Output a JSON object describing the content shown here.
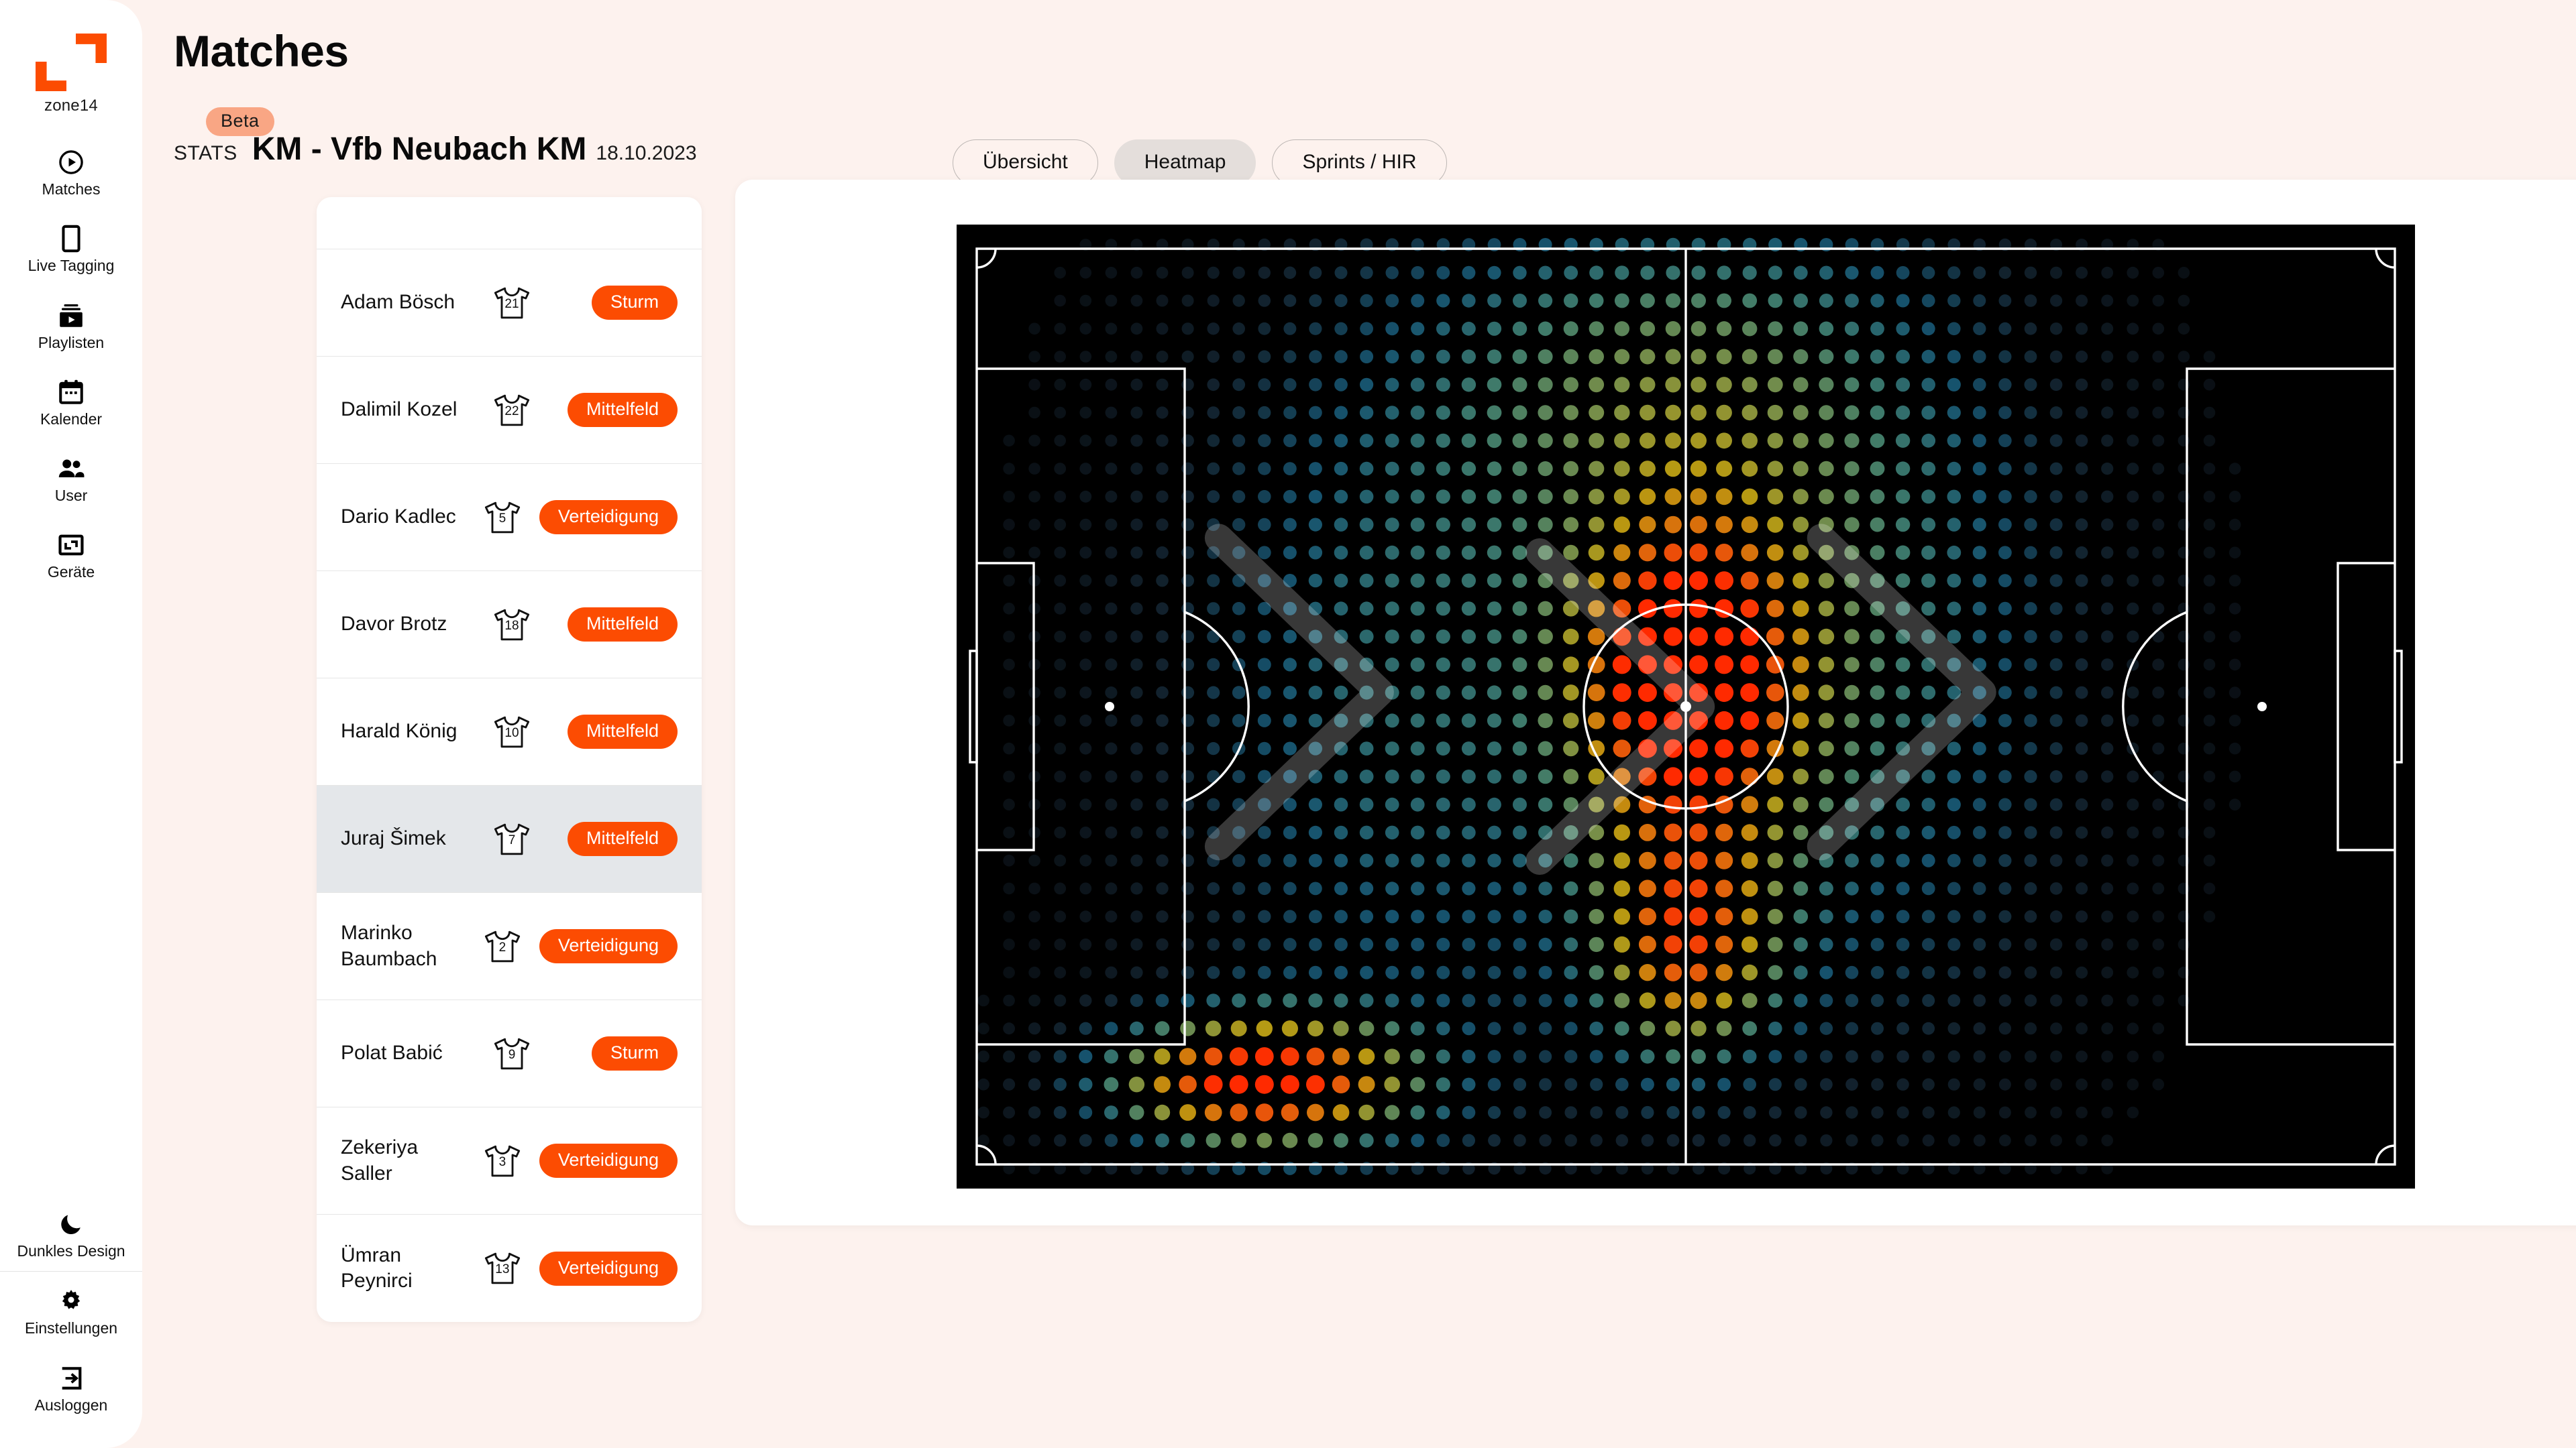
{
  "brand": {
    "name": "zone14",
    "logo_icon": "zone14-logo",
    "accent": "#FC4C02"
  },
  "sidebar": {
    "items": [
      {
        "label": "Matches",
        "icon": "play-circle-icon",
        "active": true
      },
      {
        "label": "Live Tagging",
        "icon": "mobile-icon",
        "active": false
      },
      {
        "label": "Playlisten",
        "icon": "playlist-icon",
        "active": false
      },
      {
        "label": "Kalender",
        "icon": "calendar-icon",
        "active": false
      },
      {
        "label": "User",
        "icon": "users-icon",
        "active": false
      },
      {
        "label": "Geräte",
        "icon": "devices-icon",
        "active": false
      }
    ],
    "bottom_items": [
      {
        "label": "Dunkles Design",
        "icon": "moon-icon"
      },
      {
        "label": "Einstellungen",
        "icon": "gear-icon"
      },
      {
        "label": "Ausloggen",
        "icon": "logout-icon"
      }
    ]
  },
  "header": {
    "page_title": "Matches",
    "stats_label": "STATS",
    "beta_badge": "Beta",
    "match_title": "KM - Vfb Neubach KM",
    "match_date": "18.10.2023"
  },
  "tabs": [
    {
      "label": "Übersicht",
      "active": false
    },
    {
      "label": "Heatmap",
      "active": true
    },
    {
      "label": "Sprints / HIR",
      "active": false
    }
  ],
  "players": [
    {
      "name": "Adam Bösch",
      "number": "21",
      "position": "Sturm",
      "selected": false
    },
    {
      "name": "Dalimil Kozel",
      "number": "22",
      "position": "Mittelfeld",
      "selected": false
    },
    {
      "name": "Dario Kadlec",
      "number": "5",
      "position": "Verteidigung",
      "selected": false
    },
    {
      "name": "Davor Brotz",
      "number": "18",
      "position": "Mittelfeld",
      "selected": false
    },
    {
      "name": "Harald König",
      "number": "10",
      "position": "Mittelfeld",
      "selected": false
    },
    {
      "name": "Juraj Šimek",
      "number": "7",
      "position": "Mittelfeld",
      "selected": true
    },
    {
      "name": "Marinko Baumbach",
      "number": "2",
      "position": "Verteidigung",
      "selected": false
    },
    {
      "name": "Polat Babić",
      "number": "9",
      "position": "Sturm",
      "selected": false
    },
    {
      "name": "Zekeriya Saller",
      "number": "3",
      "position": "Verteidigung",
      "selected": false
    },
    {
      "name": "Ümran Peynirci",
      "number": "13",
      "position": "Verteidigung",
      "selected": false
    }
  ],
  "chart_data": {
    "type": "heatmap",
    "title": "Heatmap",
    "xlabel": "",
    "ylabel": "",
    "grid": false,
    "legend": "none",
    "pitch": {
      "background": "#000000",
      "line_color": "#FFFFFF",
      "halves": 2,
      "features": [
        "touchlines",
        "halfway-line",
        "centre-circle",
        "centre-spot",
        "penalty-areas",
        "goal-areas",
        "penalty-spots",
        "penalty-arcs",
        "corner-arcs",
        "goals"
      ]
    },
    "colorscale": [
      {
        "stop": 0.0,
        "color": "#080C10"
      },
      {
        "stop": 0.12,
        "color": "#12222E"
      },
      {
        "stop": 0.26,
        "color": "#16536E"
      },
      {
        "stop": 0.4,
        "color": "#3E7A6B"
      },
      {
        "stop": 0.54,
        "color": "#7A8F46"
      },
      {
        "stop": 0.66,
        "color": "#B79A12"
      },
      {
        "stop": 0.78,
        "color": "#D4780C"
      },
      {
        "stop": 0.88,
        "color": "#E8550A"
      },
      {
        "stop": 1.0,
        "color": "#FF2A00"
      }
    ],
    "grid_cols": 56,
    "grid_rows": 34,
    "value_range": [
      0,
      1
    ],
    "hotspots": [
      {
        "name": "centre-circle-peak",
        "cx": 0.5,
        "cy": 0.47,
        "amplitude": 1.0,
        "sigma_x": 0.055,
        "sigma_y": 0.12
      },
      {
        "name": "bottom-left-peak",
        "cx": 0.195,
        "cy": 0.905,
        "amplitude": 1.0,
        "sigma_x": 0.075,
        "sigma_y": 0.05
      },
      {
        "name": "left-of-centre-band",
        "cx": 0.5,
        "cy": 0.76,
        "amplitude": 0.72,
        "sigma_x": 0.045,
        "sigma_y": 0.09
      },
      {
        "name": "mid-left-cool",
        "cx": 0.3,
        "cy": 0.48,
        "amplitude": 0.34,
        "sigma_x": 0.12,
        "sigma_y": 0.33
      },
      {
        "name": "upper-centre-cool",
        "cx": 0.48,
        "cy": 0.14,
        "amplitude": 0.36,
        "sigma_x": 0.11,
        "sigma_y": 0.13
      },
      {
        "name": "right-of-centre-cool",
        "cx": 0.62,
        "cy": 0.43,
        "amplitude": 0.38,
        "sigma_x": 0.11,
        "sigma_y": 0.3
      }
    ],
    "overlay_chevrons": {
      "color": "#FFFFFF",
      "opacity": 0.22,
      "count": 3,
      "direction": "right",
      "positions": [
        {
          "cx": 0.235,
          "cy": 0.485
        },
        {
          "cx": 0.455,
          "cy": 0.5
        },
        {
          "cx": 0.648,
          "cy": 0.485
        }
      ]
    }
  }
}
